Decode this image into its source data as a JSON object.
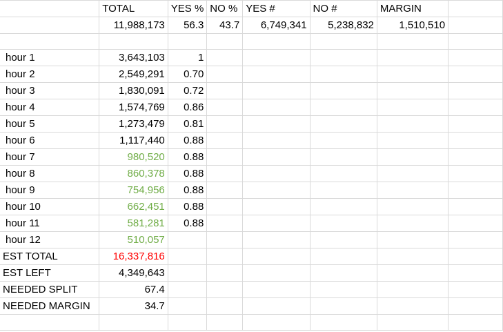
{
  "header": {
    "total": "TOTAL",
    "yes_pct": "YES %",
    "no_pct": "NO %",
    "yes_num": "YES #",
    "no_num": "NO #",
    "margin": "MARGIN"
  },
  "summary": {
    "total": "11,988,173",
    "yes_pct": "56.3",
    "no_pct": "43.7",
    "yes_num": "6,749,341",
    "no_num": "5,238,832",
    "margin": "1,510,510"
  },
  "hours": [
    {
      "label": "hour 1",
      "value": "3,643,103",
      "ratio": "1"
    },
    {
      "label": "hour 2",
      "value": "2,549,291",
      "ratio": "0.70"
    },
    {
      "label": "hour 3",
      "value": "1,830,091",
      "ratio": "0.72"
    },
    {
      "label": "hour 4",
      "value": "1,574,769",
      "ratio": "0.86"
    },
    {
      "label": "hour 5",
      "value": "1,273,479",
      "ratio": "0.81"
    },
    {
      "label": "hour 6",
      "value": "1,117,440",
      "ratio": "0.88"
    },
    {
      "label": "hour 7",
      "value": "980,520",
      "ratio": "0.88"
    },
    {
      "label": "hour 8",
      "value": "860,378",
      "ratio": "0.88"
    },
    {
      "label": "hour 9",
      "value": "754,956",
      "ratio": "0.88"
    },
    {
      "label": "hour 10",
      "value": "662,451",
      "ratio": "0.88"
    },
    {
      "label": "hour 11",
      "value": "581,281",
      "ratio": "0.88"
    },
    {
      "label": "hour 12",
      "value": "510,057",
      "ratio": ""
    }
  ],
  "totals": {
    "est_total_label": "EST TOTAL",
    "est_total": "16,337,816",
    "est_left_label": "EST LEFT",
    "est_left": "4,349,643",
    "needed_split_label": "NEEDED SPLIT",
    "needed_split": "67.4",
    "needed_margin_label": "NEEDED MARGIN",
    "needed_margin": "34.7"
  },
  "colors": {
    "estimated_value": "#70ad47",
    "est_total": "#ff0000",
    "gridline": "#d9d9d9"
  }
}
